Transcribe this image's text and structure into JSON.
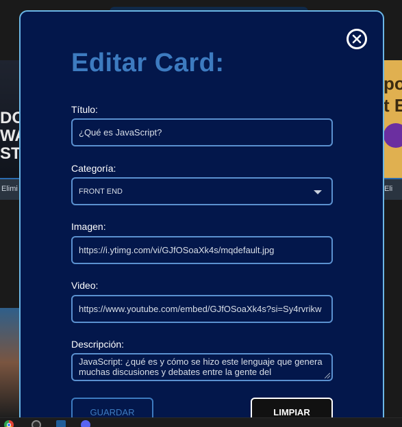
{
  "background": {
    "left_card_text": "DOU\nWAR\nST?",
    "left_bar_label": "Elimi",
    "right_card_text": "po\nt E",
    "right_bar_label": "Eli"
  },
  "modal": {
    "title": "Editar Card:",
    "close_icon": "close-circle-icon",
    "fields": {
      "titulo": {
        "label": "Título:",
        "value": "¿Qué es JavaScript?"
      },
      "categoria": {
        "label": "Categoría:",
        "value": "FRONT END",
        "icon": "chevron-down-icon"
      },
      "imagen": {
        "label": "Imagen:",
        "value": "https://i.ytimg.com/vi/GJfOSoaXk4s/mqdefault.jpg"
      },
      "video": {
        "label": "Video:",
        "value": "https://www.youtube.com/embed/GJfOSoaXk4s?si=Sy4rvrikw"
      },
      "descripcion": {
        "label": "Descripción:",
        "value": "JavaScript: ¿qué es y cómo se hizo este lenguaje que genera muchas discusiones y debates entre la gente del"
      }
    },
    "buttons": {
      "save_label": "GUARDAR",
      "clear_label": "LIMPIAR"
    }
  },
  "colors": {
    "modal_bg": "#03174b",
    "accent": "#3d7bc0",
    "border": "#5b91d0",
    "modal_outline": "#6bb7e6"
  },
  "taskbar": {
    "icons": [
      "chrome-icon",
      "app-icon",
      "vscode-icon",
      "discord-icon"
    ]
  }
}
